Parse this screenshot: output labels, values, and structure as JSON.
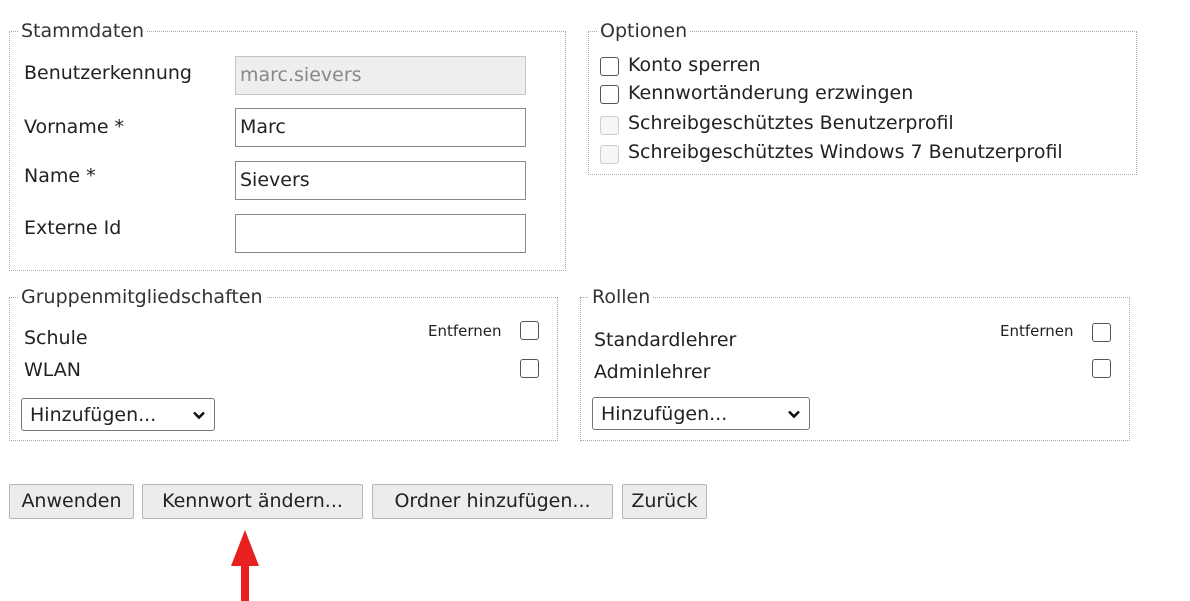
{
  "stammdaten": {
    "legend": "Stammdaten",
    "fields": [
      {
        "label": "Benutzerkennung",
        "value": "marc.sievers",
        "readonly": true
      },
      {
        "label": "Vorname *",
        "value": "Marc"
      },
      {
        "label": "Name *",
        "value": "Sievers"
      },
      {
        "label": "Externe Id",
        "value": ""
      }
    ]
  },
  "optionen": {
    "legend": "Optionen",
    "items": [
      {
        "label": "Konto sperren",
        "checked": false,
        "disabled": false
      },
      {
        "label": "Kennwortänderung erzwingen",
        "checked": false,
        "disabled": false
      },
      {
        "label": "Schreibgeschütztes Benutzerprofil",
        "checked": false,
        "disabled": true
      },
      {
        "label": "Schreibgeschütztes Windows 7 Benutzerprofil",
        "checked": false,
        "disabled": true
      }
    ]
  },
  "gruppen": {
    "legend": "Gruppenmitgliedschaften",
    "remove_label": "Entfernen",
    "items": [
      "Schule",
      "WLAN"
    ],
    "add_select": "Hinzufügen..."
  },
  "rollen": {
    "legend": "Rollen",
    "remove_label": "Entfernen",
    "items": [
      "Standardlehrer",
      "Adminlehrer"
    ],
    "add_select": "Hinzufügen..."
  },
  "buttons": {
    "apply": "Anwenden",
    "change_password": "Kennwort ändern...",
    "add_folder": "Ordner hinzufügen...",
    "back": "Zurück"
  },
  "annotation": {
    "arrow_color": "#e8201f",
    "target": "Kennwort ändern..."
  },
  "icons": {
    "select_chevron": "chevron-down-icon"
  }
}
